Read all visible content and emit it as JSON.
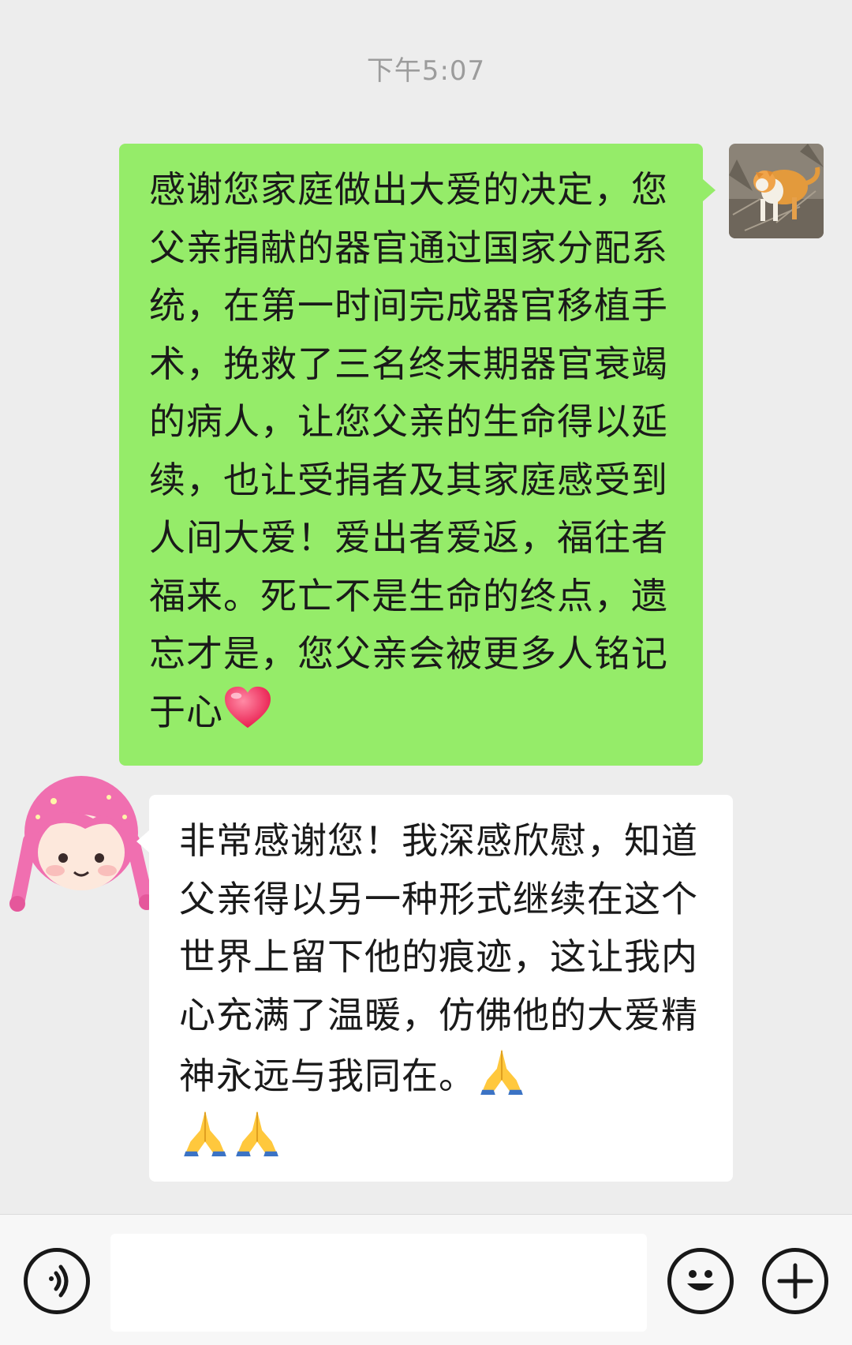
{
  "timestamp": "下午5:07",
  "messages": [
    {
      "direction": "outgoing",
      "text": "感谢您家庭做出大爱的决定，您父亲捐献的器官通过国家分配系统，在第一时间完成器官移植手术，挽救了三名终末期器官衰竭的病人，让您父亲的生命得以延续，也让受捐者及其家庭感受到人间大爱！爱出者爱返，福往者福来。死亡不是生命的终点，遗忘才是，您父亲会被更多人铭记于心",
      "emoji": "red-heart-icon",
      "avatar": "cat-photo-avatar",
      "bubble_color": "#95ec69"
    },
    {
      "direction": "incoming",
      "text": "非常感谢您！我深感欣慰，知道父亲得以另一种形式继续在这个世界上留下他的痕迹，这让我内心充满了温暖，仿佛他的大爱精神永远与我同在。",
      "emoji": "folded-hands-icon",
      "emoji_count": 3,
      "avatar": "pink-hair-girl-avatar",
      "bubble_color": "#ffffff"
    }
  ],
  "input_bar": {
    "voice_icon": "voice-icon",
    "emoji_icon": "emoji-smile-icon",
    "more_icon": "plus-icon"
  },
  "colors": {
    "background": "#ededed",
    "outgoing_bubble": "#95ec69",
    "incoming_bubble": "#ffffff"
  }
}
